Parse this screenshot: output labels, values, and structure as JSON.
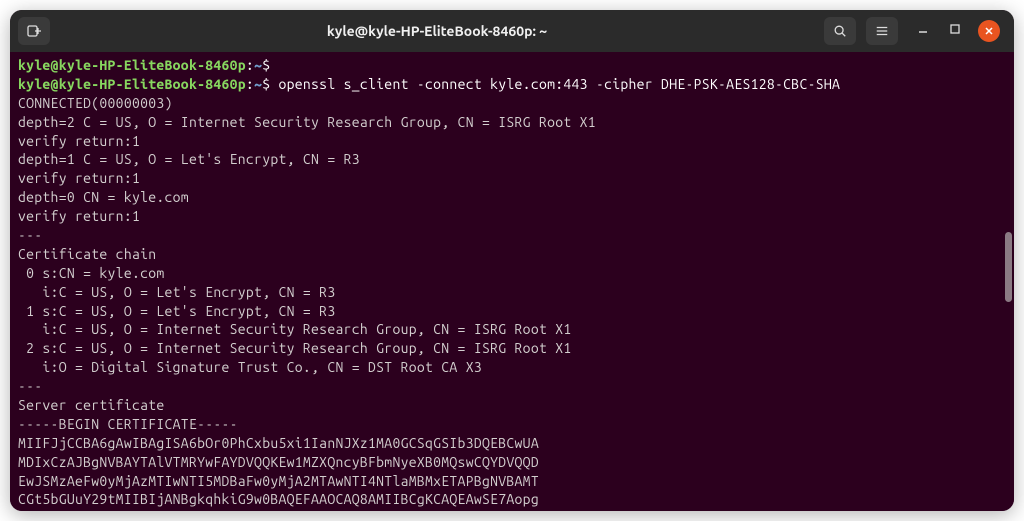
{
  "titlebar": {
    "title": "kyle@kyle-HP-EliteBook-8460p: ~"
  },
  "prompt": {
    "user_host": "kyle@kyle-HP-EliteBook-8460p",
    "colon": ":",
    "path": "~",
    "dollar": "$"
  },
  "cmd1": " ",
  "cmd2": " openssl s_client -connect kyle.com:443 -cipher DHE-PSK-AES128-CBC-SHA",
  "out": {
    "l1": "CONNECTED(00000003)",
    "l2": "depth=2 C = US, O = Internet Security Research Group, CN = ISRG Root X1",
    "l3": "verify return:1",
    "l4": "depth=1 C = US, O = Let's Encrypt, CN = R3",
    "l5": "verify return:1",
    "l6": "depth=0 CN = kyle.com",
    "l7": "verify return:1",
    "l8": "---",
    "l9": "Certificate chain",
    "l10": " 0 s:CN = kyle.com",
    "l11": "   i:C = US, O = Let's Encrypt, CN = R3",
    "l12": " 1 s:C = US, O = Let's Encrypt, CN = R3",
    "l13": "   i:C = US, O = Internet Security Research Group, CN = ISRG Root X1",
    "l14": " 2 s:C = US, O = Internet Security Research Group, CN = ISRG Root X1",
    "l15": "   i:O = Digital Signature Trust Co., CN = DST Root CA X3",
    "l16": "---",
    "l17": "Server certificate",
    "l18": "-----BEGIN CERTIFICATE-----",
    "l19": "MIIFJjCCBA6gAwIBAgISA6bOr0PhCxbu5xi1IanNJXz1MA0GCSqGSIb3DQEBCwUA",
    "l20": "MDIxCzAJBgNVBAYTAlVTMRYwFAYDVQQKEw1MZXQncyBFbmNyeXB0MQswCQYDVQQD",
    "l21": "EwJSMzAeFw0yMjAzMTIwNTI5MDBaFw0yMjA2MTAwNTI4NTlaMBMxETAPBgNVBAMT",
    "l22": "CGt5bGUuY29tMIIBIjANBgkqhkiG9w0BAQEFAAOCAQ8AMIIBCgKCAQEAwSE7Aopg"
  }
}
